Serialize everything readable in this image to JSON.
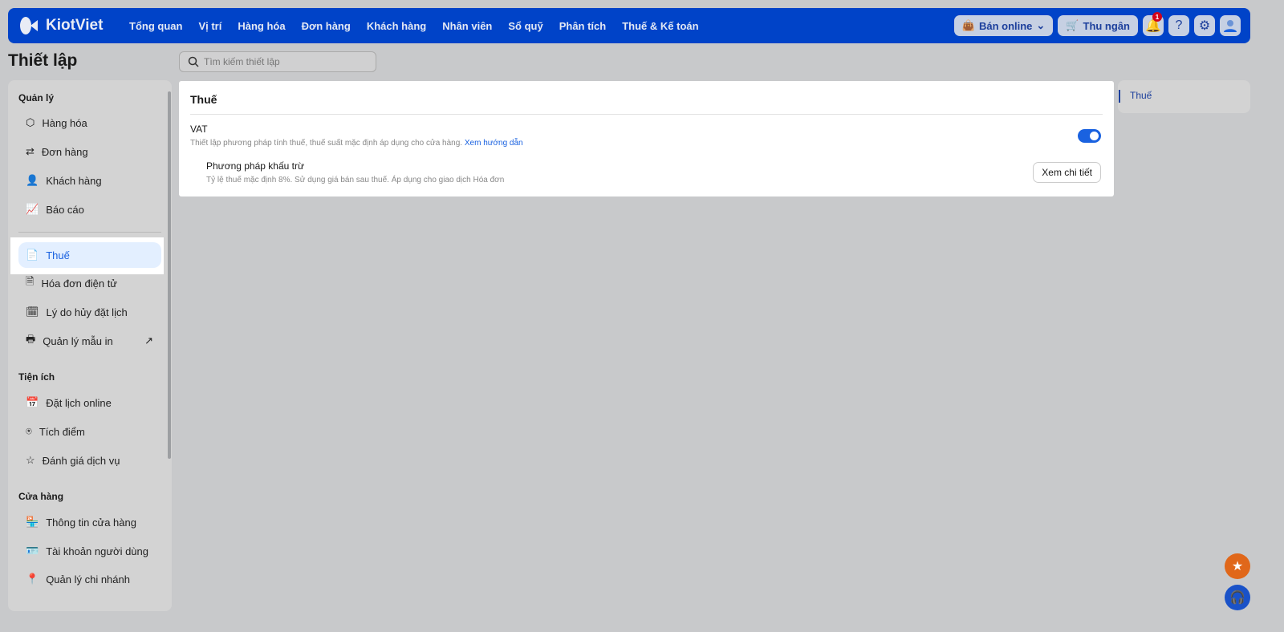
{
  "header": {
    "logo": "KiotViet",
    "menu": [
      "Tổng quan",
      "Vị trí",
      "Hàng hóa",
      "Đơn hàng",
      "Khách hàng",
      "Nhân viên",
      "Sổ quỹ",
      "Phân tích",
      "Thuế & Kế toán"
    ],
    "sell_online": "Bán online",
    "cashier": "Thu ngân",
    "notification_count": "1"
  },
  "page": {
    "title": "Thiết lập",
    "search_placeholder": "Tìm kiếm thiết lập"
  },
  "sidebar": {
    "sections": [
      "Quản lý",
      "Tiện ích",
      "Cửa hàng"
    ],
    "manage": [
      "Hàng hóa",
      "Đơn hàng",
      "Khách hàng",
      "Báo cáo"
    ],
    "manage2": [
      "Thuế",
      "Hóa đơn điện tử",
      "Lý do hủy đặt lịch",
      "Quản lý mẫu in"
    ],
    "utilities": [
      "Đặt lịch online",
      "Tích điểm",
      "Đánh giá dịch vụ"
    ],
    "store": [
      "Thông tin cửa hàng",
      "Tài khoản người dùng",
      "Quản lý chi nhánh"
    ]
  },
  "card": {
    "title": "Thuế",
    "vat_label": "VAT",
    "vat_desc": "Thiết lập phương pháp tính thuế, thuế suất mặc định áp dụng cho cửa hàng.",
    "guide_link": "Xem hướng dẫn",
    "vat_enabled": true,
    "method_title": "Phương pháp khấu trừ",
    "method_desc": "Tỷ lệ thuế mặc định 8%. Sử dụng giá bán sau thuế. Áp dụng cho giao dịch Hóa đơn",
    "detail_button": "Xem chi tiết"
  },
  "toc": {
    "items": [
      "Thuế"
    ]
  },
  "colors": {
    "brand": "#0043c8",
    "accent": "#1a62e0"
  }
}
